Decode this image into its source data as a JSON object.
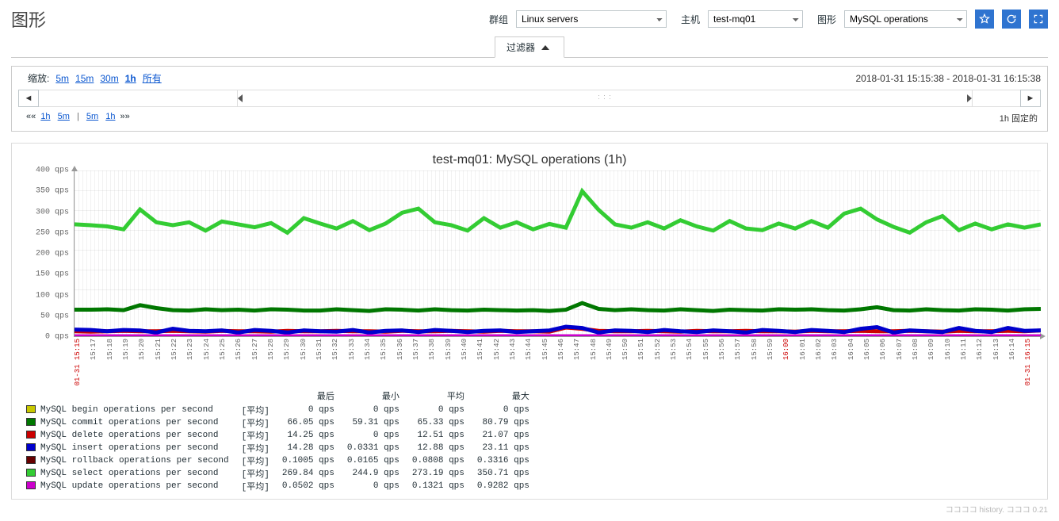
{
  "page_title": "图形",
  "selectors": {
    "group_label": "群组",
    "group_value": "Linux servers",
    "host_label": "主机",
    "host_value": "test-mq01",
    "graph_label": "图形",
    "graph_value": "MySQL operations"
  },
  "filter_tab": "过滤器",
  "zoom": {
    "label": "缩放:",
    "opts": [
      "5m",
      "15m",
      "30m",
      "1h",
      "所有"
    ],
    "active": "1h"
  },
  "time_range": "2018-01-31 15:15:38 - 2018-01-31 16:15:38",
  "nav": {
    "left_prefix": "««",
    "left_a": "1h",
    "left_b": "5m",
    "sep": "|",
    "right_a": "5m",
    "right_b": "1h",
    "right_suffix": "»»",
    "fixed": "1h  固定的"
  },
  "chart_data": {
    "type": "line",
    "title": "test-mq01: MySQL operations (1h)",
    "ylabel_suffix": " qps",
    "ylim": [
      0,
      400
    ],
    "yticks": [
      0,
      50,
      100,
      150,
      200,
      250,
      300,
      350,
      400
    ],
    "x_categories": [
      "01-31 15:15",
      "15:17",
      "15:18",
      "15:19",
      "15:20",
      "15:21",
      "15:22",
      "15:23",
      "15:24",
      "15:25",
      "15:26",
      "15:27",
      "15:28",
      "15:29",
      "15:30",
      "15:31",
      "15:32",
      "15:33",
      "15:34",
      "15:35",
      "15:36",
      "15:37",
      "15:38",
      "15:39",
      "15:40",
      "15:41",
      "15:42",
      "15:43",
      "15:44",
      "15:45",
      "15:46",
      "15:47",
      "15:48",
      "15:49",
      "15:50",
      "15:51",
      "15:52",
      "15:53",
      "15:54",
      "15:55",
      "15:56",
      "15:57",
      "15:58",
      "15:59",
      "16:00",
      "16:01",
      "16:02",
      "16:03",
      "16:04",
      "16:05",
      "16:06",
      "16:07",
      "16:08",
      "16:09",
      "16:10",
      "16:11",
      "16:12",
      "16:13",
      "16:14",
      "01-31 16:15"
    ],
    "x_red_indices": [
      0,
      44,
      59
    ],
    "series": [
      {
        "name": "MySQL begin operations per second",
        "color": "#c8c800",
        "agg": "[平均]",
        "last": "0 qps",
        "min": "0 qps",
        "avg": "0 qps",
        "max": "0 qps",
        "values": [
          0,
          0,
          0,
          0,
          0,
          0,
          0,
          0,
          0,
          0,
          0,
          0,
          0,
          0,
          0,
          0,
          0,
          0,
          0,
          0,
          0,
          0,
          0,
          0,
          0,
          0,
          0,
          0,
          0,
          0,
          0,
          0,
          0,
          0,
          0,
          0,
          0,
          0,
          0,
          0,
          0,
          0,
          0,
          0,
          0,
          0,
          0,
          0,
          0,
          0,
          0,
          0,
          0,
          0,
          0,
          0,
          0,
          0,
          0,
          0
        ]
      },
      {
        "name": "MySQL commit operations per second",
        "color": "#007700",
        "agg": "[平均]",
        "last": "66.05 qps",
        "min": "59.31 qps",
        "avg": "65.33 qps",
        "max": "80.79 qps",
        "values": [
          64,
          64,
          65,
          63,
          75,
          68,
          63,
          62,
          65,
          63,
          64,
          62,
          65,
          64,
          62,
          62,
          65,
          63,
          61,
          65,
          64,
          62,
          65,
          63,
          62,
          64,
          63,
          62,
          63,
          61,
          64,
          80,
          66,
          63,
          65,
          63,
          62,
          65,
          63,
          61,
          64,
          63,
          62,
          65,
          64,
          65,
          63,
          62,
          65,
          70,
          63,
          62,
          65,
          63,
          62,
          65,
          64,
          62,
          65,
          66
        ]
      },
      {
        "name": "MySQL delete operations per second",
        "color": "#cc0000",
        "agg": "[平均]",
        "last": "14.25 qps",
        "min": "0 qps",
        "avg": "12.51 qps",
        "max": "21.07 qps",
        "values": [
          12,
          11,
          12,
          13,
          12,
          12,
          13,
          12,
          11,
          13,
          12,
          12,
          11,
          13,
          12,
          12,
          13,
          12,
          12,
          11,
          13,
          12,
          12,
          13,
          12,
          11,
          13,
          12,
          12,
          11,
          21,
          18,
          13,
          12,
          12,
          13,
          12,
          11,
          13,
          12,
          12,
          13,
          12,
          12,
          11,
          13,
          12,
          12,
          13,
          12,
          12,
          13,
          12,
          11,
          13,
          12,
          12,
          13,
          12,
          14
        ]
      },
      {
        "name": "MySQL insert operations per second",
        "color": "#0000cc",
        "agg": "[平均]",
        "last": "14.28 qps",
        "min": "0.0331 qps",
        "avg": "12.88 qps",
        "max": "23.11 qps",
        "values": [
          16,
          15,
          12,
          15,
          14,
          9,
          18,
          13,
          12,
          14,
          9,
          15,
          13,
          9,
          14,
          12,
          11,
          15,
          9,
          13,
          14,
          10,
          15,
          13,
          10,
          13,
          14,
          10,
          12,
          14,
          23,
          20,
          9,
          14,
          13,
          10,
          15,
          12,
          10,
          14,
          12,
          9,
          15,
          13,
          10,
          15,
          13,
          10,
          18,
          22,
          9,
          14,
          12,
          10,
          20,
          13,
          10,
          20,
          13,
          14
        ]
      },
      {
        "name": "MySQL rollback operations per second",
        "color": "#660000",
        "agg": "[平均]",
        "last": "0.1005 qps",
        "min": "0.0165 qps",
        "avg": "0.0808 qps",
        "max": "0.3316 qps",
        "values": [
          0,
          0,
          0,
          0,
          0,
          0,
          0,
          0,
          0,
          0,
          0,
          0,
          0,
          0,
          0,
          0,
          0,
          0,
          0,
          0,
          0,
          0,
          0,
          0,
          0,
          0,
          0,
          0,
          0,
          0,
          0,
          0,
          0,
          0,
          0,
          0,
          0,
          0,
          0,
          0,
          0,
          0,
          0,
          0,
          0,
          0,
          0,
          0,
          0,
          0,
          0,
          0,
          0,
          0,
          0,
          0,
          0,
          0,
          0,
          0
        ]
      },
      {
        "name": "MySQL select operations per second",
        "color": "#33cc33",
        "agg": "[平均]",
        "last": "269.84 qps",
        "min": "244.9 qps",
        "avg": "273.19 qps",
        "max": "350.71 qps",
        "values": [
          270,
          268,
          265,
          258,
          306,
          275,
          268,
          275,
          255,
          277,
          270,
          263,
          273,
          250,
          285,
          272,
          260,
          278,
          256,
          272,
          298,
          308,
          275,
          268,
          255,
          285,
          262,
          275,
          258,
          271,
          262,
          350,
          305,
          270,
          262,
          275,
          260,
          280,
          265,
          255,
          278,
          260,
          256,
          272,
          260,
          278,
          262,
          296,
          308,
          282,
          264,
          250,
          275,
          290,
          256,
          272,
          258,
          270,
          262,
          270
        ]
      },
      {
        "name": "MySQL update operations per second",
        "color": "#cc00cc",
        "agg": "[平均]",
        "last": "0.0502 qps",
        "min": "0 qps",
        "avg": "0.1321 qps",
        "max": "0.9282 qps",
        "values": [
          0,
          0,
          0,
          0,
          0,
          0,
          0,
          0,
          0,
          0,
          0,
          0,
          0,
          0,
          0,
          0,
          0,
          0,
          0,
          0,
          0,
          0,
          0,
          0,
          0,
          0,
          0,
          0,
          0,
          0,
          0,
          0,
          0,
          0,
          0,
          0,
          0,
          0,
          0,
          0,
          0,
          0,
          0,
          0,
          0,
          0,
          0,
          0,
          0,
          0,
          0,
          0,
          0,
          0,
          0,
          0,
          0,
          0,
          0,
          0
        ]
      }
    ],
    "legend_headers": [
      "最后",
      "最小",
      "平均",
      "最大"
    ]
  },
  "footer": "ココココ history. コココ 0.21"
}
